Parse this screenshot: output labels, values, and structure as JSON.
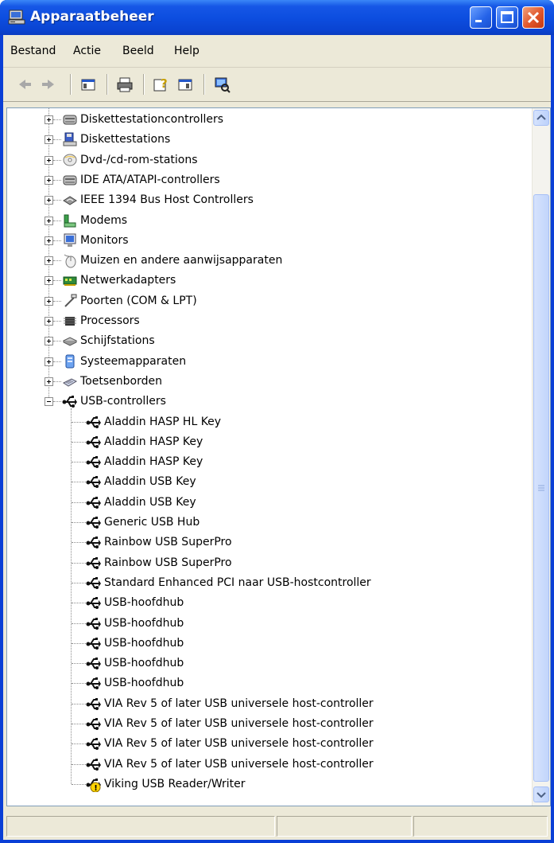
{
  "window": {
    "title": "Apparaatbeheer"
  },
  "menubar": {
    "items": [
      {
        "label": "Bestand"
      },
      {
        "label": "Actie"
      },
      {
        "label": "Beeld"
      },
      {
        "label": "Help"
      }
    ]
  },
  "toolbar": {
    "buttons": [
      "back-icon",
      "forward-icon",
      "show-hide-console-tree-icon",
      "print-icon",
      "help-icon",
      "show-hide-action-pane-icon",
      "scan-hardware-icon"
    ]
  },
  "tree": {
    "categories": [
      {
        "label": "Diskettestationcontrollers",
        "icon": "floppy-controller-icon",
        "expanded": false
      },
      {
        "label": "Diskettestations",
        "icon": "floppy-drive-icon",
        "expanded": false
      },
      {
        "label": "Dvd-/cd-rom-stations",
        "icon": "cdrom-icon",
        "expanded": false
      },
      {
        "label": "IDE ATA/ATAPI-controllers",
        "icon": "ide-controller-icon",
        "expanded": false
      },
      {
        "label": "IEEE 1394 Bus Host Controllers",
        "icon": "firewire-icon",
        "expanded": false
      },
      {
        "label": "Modems",
        "icon": "modem-icon",
        "expanded": false
      },
      {
        "label": "Monitors",
        "icon": "monitor-icon",
        "expanded": false
      },
      {
        "label": "Muizen en andere aanwijsapparaten",
        "icon": "mouse-icon",
        "expanded": false
      },
      {
        "label": "Netwerkadapters",
        "icon": "network-adapter-icon",
        "expanded": false
      },
      {
        "label": "Poorten (COM & LPT)",
        "icon": "port-icon",
        "expanded": false
      },
      {
        "label": "Processors",
        "icon": "processor-icon",
        "expanded": false
      },
      {
        "label": "Schijfstations",
        "icon": "disk-drive-icon",
        "expanded": false
      },
      {
        "label": "Systeemapparaten",
        "icon": "system-device-icon",
        "expanded": false
      },
      {
        "label": "Toetsenborden",
        "icon": "keyboard-icon",
        "expanded": false
      },
      {
        "label": "USB-controllers",
        "icon": "usb-icon",
        "expanded": true
      }
    ],
    "usb_children": [
      {
        "label": "Aladdin HASP HL Key",
        "warning": false
      },
      {
        "label": "Aladdin HASP Key",
        "warning": false
      },
      {
        "label": "Aladdin HASP Key",
        "warning": false
      },
      {
        "label": "Aladdin USB Key",
        "warning": false
      },
      {
        "label": "Aladdin USB Key",
        "warning": false
      },
      {
        "label": "Generic USB Hub",
        "warning": false
      },
      {
        "label": "Rainbow USB SuperPro",
        "warning": false
      },
      {
        "label": "Rainbow USB SuperPro",
        "warning": false
      },
      {
        "label": "Standard Enhanced PCI naar USB-hostcontroller",
        "warning": false
      },
      {
        "label": "USB-hoofdhub",
        "warning": false
      },
      {
        "label": "USB-hoofdhub",
        "warning": false
      },
      {
        "label": "USB-hoofdhub",
        "warning": false
      },
      {
        "label": "USB-hoofdhub",
        "warning": false
      },
      {
        "label": "USB-hoofdhub",
        "warning": false
      },
      {
        "label": "VIA Rev 5 of later USB universele host-controller",
        "warning": false
      },
      {
        "label": "VIA Rev 5 of later USB universele host-controller",
        "warning": false
      },
      {
        "label": "VIA Rev 5 of later USB universele host-controller",
        "warning": false
      },
      {
        "label": "VIA Rev 5 of later USB universele host-controller",
        "warning": false
      },
      {
        "label": "Viking USB Reader/Writer",
        "warning": true
      }
    ]
  },
  "colors": {
    "titlebar": "#0a44d2",
    "window_face": "#ece9d8",
    "warning": "#ffd400"
  }
}
